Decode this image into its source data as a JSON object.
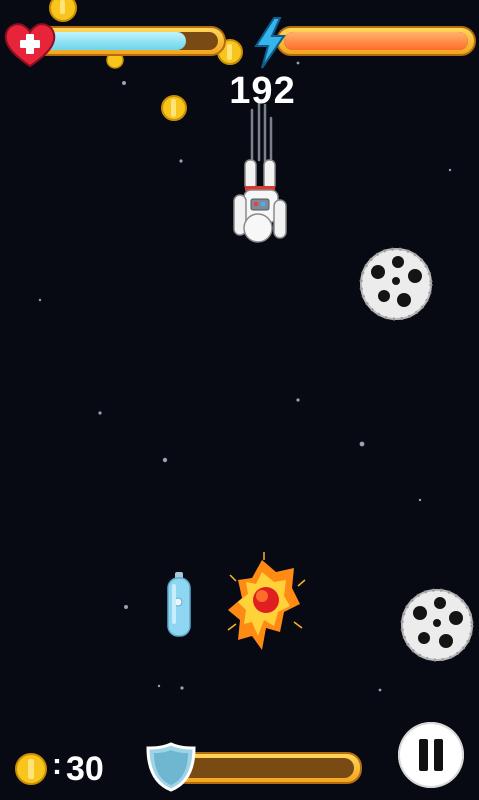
{
  "hud": {
    "score": "192",
    "health_level": 0.82,
    "energy_level": 1.0,
    "health_icon": "heart-plus-icon",
    "energy_icon": "lightning-bolt-icon"
  },
  "footer": {
    "coin_separator": ":",
    "coin_count": "30",
    "shield_level": 0.0,
    "shield_icon": "shield-icon",
    "pause_icon": "pause-icon"
  },
  "colors": {
    "background": "#070a12",
    "bar_frame": "#f2a51e",
    "health_fill": "#6cd4ea",
    "energy_fill": "#ff6b2a",
    "heart": "#e8243a",
    "bolt": "#35b5ec",
    "coin": "#f7c51c"
  },
  "scene": {
    "player": "astronaut",
    "enemies": [
      "asteroid",
      "asteroid"
    ],
    "pickups": [
      "coin",
      "coin",
      "coin",
      "oxygen-tank"
    ],
    "effects": [
      "fireball-explosion"
    ]
  }
}
